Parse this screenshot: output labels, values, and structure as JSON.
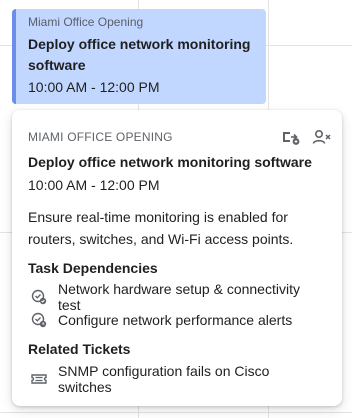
{
  "event": {
    "group": "Miami Office Opening",
    "title_line1": "Deploy office network monitoring",
    "title_line2": "software",
    "time": "10:00 AM - 12:00 PM"
  },
  "popover": {
    "group": "MIAMI OFFICE OPENING",
    "title": "Deploy office network monitoring software",
    "time": "10:00 AM - 12:00 PM",
    "description": "Ensure real-time monitoring is enabled for routers, switches, and Wi-Fi access points.",
    "actions": {
      "move_icon": "calendar-move-icon",
      "remove_person_icon": "person-remove-icon"
    },
    "dependencies_title": "Task Dependencies",
    "dependencies": [
      {
        "label": "Network hardware setup & connectivity test",
        "icon": "task-done-icon"
      },
      {
        "label": "Configure network performance alerts",
        "icon": "task-pending-icon"
      }
    ],
    "tickets_title": "Related Tickets",
    "tickets": [
      {
        "label": "SNMP configuration fails on Cisco switches",
        "icon": "ticket-icon"
      }
    ]
  },
  "colors": {
    "event_bg": "#c2d7ff",
    "event_accent": "#6b8fe8",
    "text": "#1f1f1f",
    "muted": "#5f6368"
  }
}
